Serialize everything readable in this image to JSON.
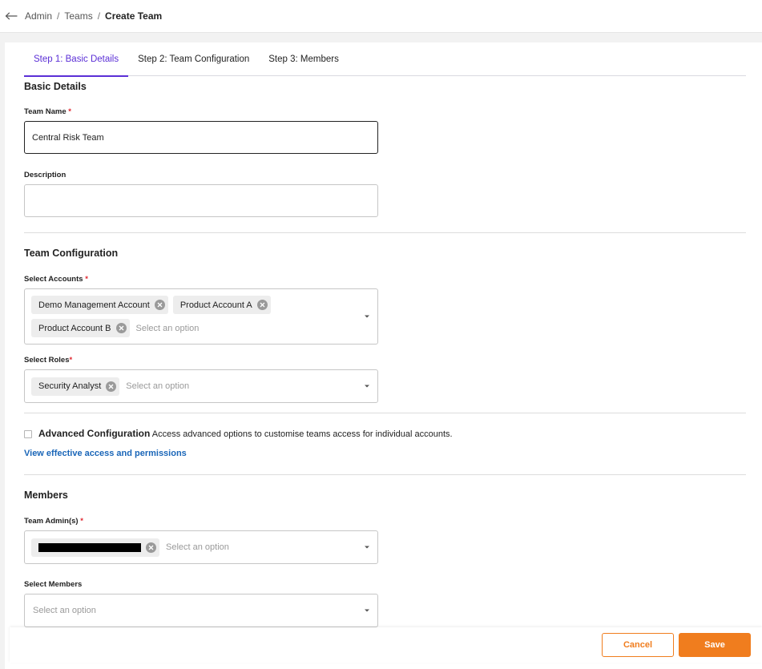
{
  "breadcrumb": {
    "items": [
      "Admin",
      "Teams"
    ],
    "separator": "/",
    "current": "Create Team"
  },
  "tabs": [
    {
      "label": "Step 1: Basic Details",
      "active": true
    },
    {
      "label": "Step 2: Team Configuration",
      "active": false
    },
    {
      "label": "Step 3: Members",
      "active": false
    }
  ],
  "basic_details": {
    "title": "Basic Details",
    "team_name": {
      "label": "Team Name",
      "required_mark": "*",
      "value": "Central Risk Team"
    },
    "description": {
      "label": "Description",
      "value": ""
    }
  },
  "team_configuration": {
    "title": "Team Configuration",
    "accounts": {
      "label": "Select Accounts",
      "required_mark": "*",
      "chips": [
        "Demo Management Account",
        "Product Account A",
        "Product Account B"
      ],
      "placeholder": "Select an option"
    },
    "roles": {
      "label": "Select Roles",
      "required_mark": "*",
      "chips": [
        "Security Analyst"
      ],
      "placeholder": "Select an option"
    },
    "advanced": {
      "title": "Advanced Configuration",
      "description": "Access advanced options to customise teams access for individual accounts.",
      "checked": false
    },
    "link": "View effective access and permissions"
  },
  "members": {
    "title": "Members",
    "team_admins": {
      "label": "Team Admin(s)",
      "required_mark": "*",
      "placeholder": "Select an option"
    },
    "select_members": {
      "label": "Select Members",
      "placeholder": "Select an option"
    }
  },
  "footer": {
    "cancel_label": "Cancel",
    "save_label": "Save"
  },
  "colors": {
    "accent": "#5b2fd6",
    "primary": "#f07d1e",
    "link": "#1a66b8",
    "required": "#e0262f"
  },
  "icons": {
    "back": "arrow-left-icon",
    "chip_remove": "close-circle-icon",
    "dropdown": "caret-down-icon"
  }
}
